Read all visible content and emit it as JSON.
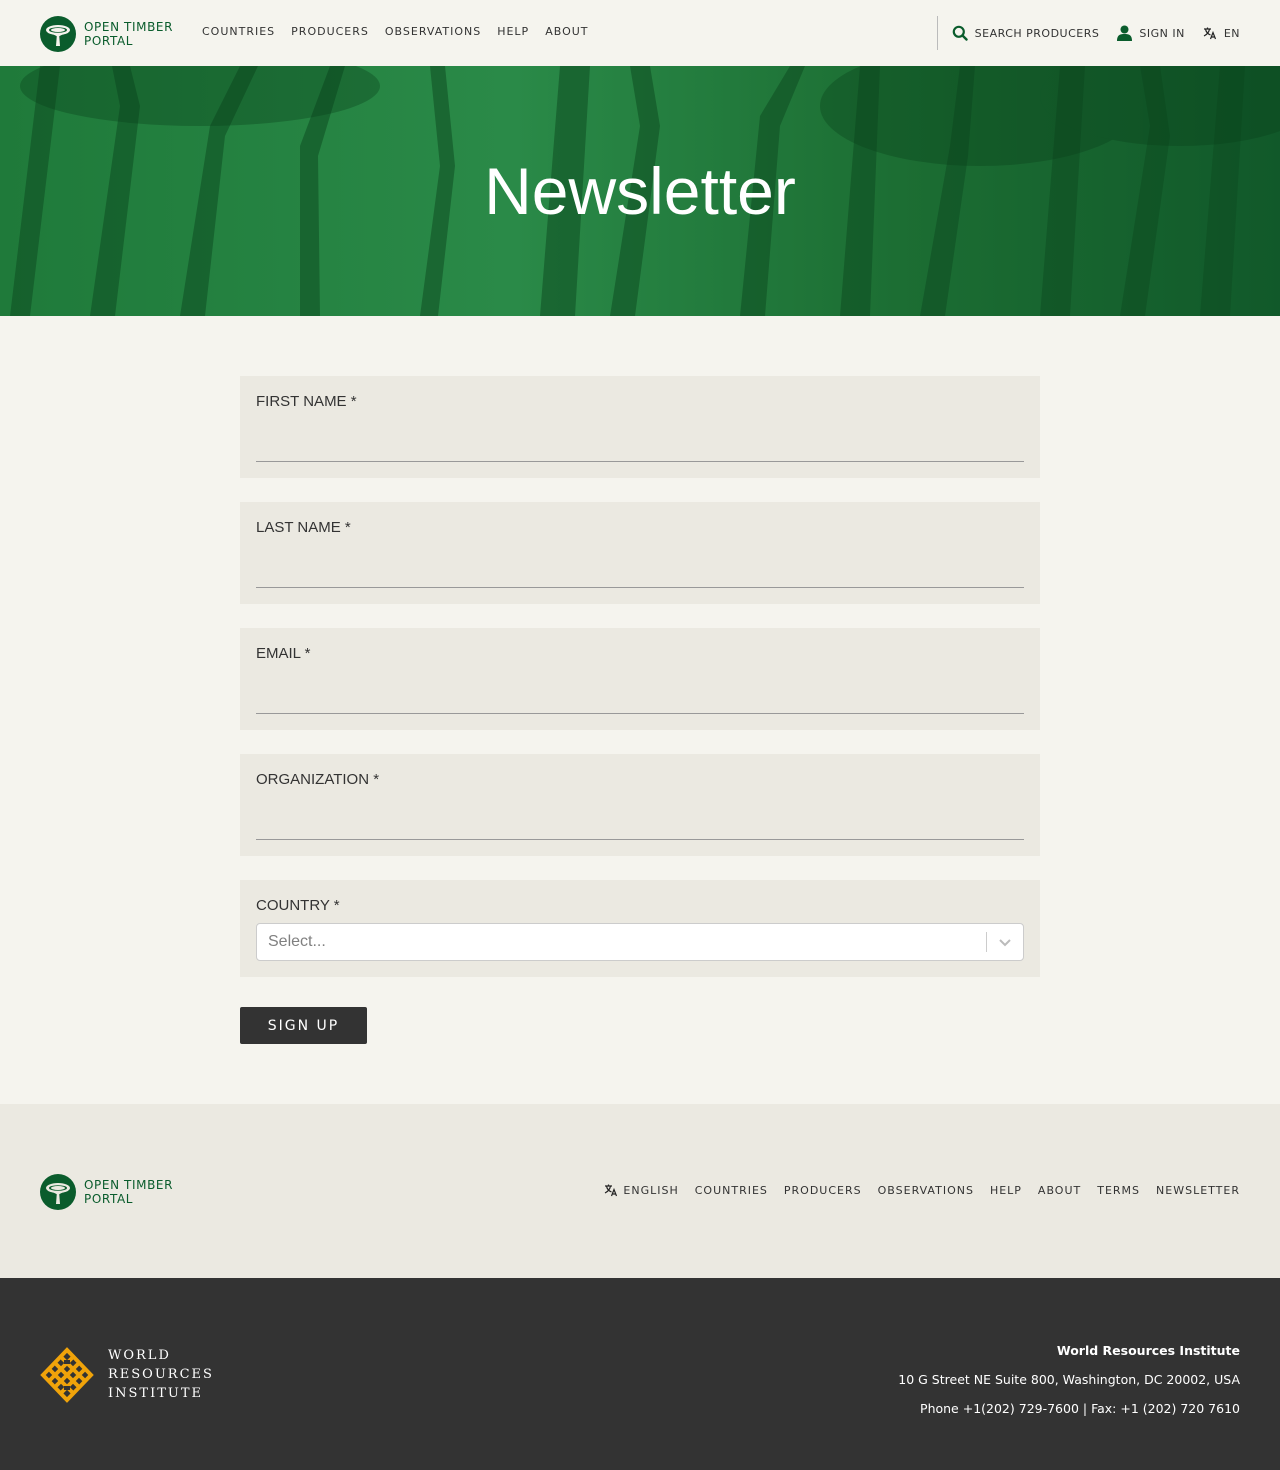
{
  "brand": {
    "line1": "OPEN TIMBER",
    "line2": "PORTAL"
  },
  "nav": [
    "COUNTRIES",
    "PRODUCERS",
    "OBSERVATIONS",
    "HELP",
    "ABOUT"
  ],
  "header_actions": {
    "search": "SEARCH PRODUCERS",
    "sign_in": "SIGN IN",
    "language": "EN"
  },
  "hero": {
    "title": "Newsletter"
  },
  "form": {
    "fields": [
      {
        "label": "FIRST NAME *",
        "value": ""
      },
      {
        "label": "LAST NAME *",
        "value": ""
      },
      {
        "label": "EMAIL *",
        "value": ""
      },
      {
        "label": "ORGANIZATION *",
        "value": ""
      }
    ],
    "country": {
      "label": "COUNTRY *",
      "placeholder": "Select..."
    },
    "submit_label": "SIGN UP"
  },
  "footer_nav": {
    "language": "ENGLISH",
    "links": [
      "COUNTRIES",
      "PRODUCERS",
      "OBSERVATIONS",
      "HELP",
      "ABOUT",
      "TERMS",
      "NEWSLETTER"
    ]
  },
  "wri": {
    "line1": "WORLD",
    "line2": "RESOURCES",
    "line3": "INSTITUTE"
  },
  "contact": {
    "org": "World Resources Institute",
    "address": "10 G Street NE Suite 800, Washington, DC 20002, USA",
    "phone": "Phone +1(202) 729-7600 | Fax: +1 (202) 720 7610"
  },
  "colors": {
    "brand_green": "#0a5c2c",
    "hero_green": "#1a6a30",
    "dark": "#333333",
    "wri_orange": "#f0a30a"
  },
  "icons": [
    "tree-logo-icon",
    "search-icon",
    "user-icon",
    "translate-icon",
    "chevron-down-icon",
    "wri-logo-icon"
  ]
}
